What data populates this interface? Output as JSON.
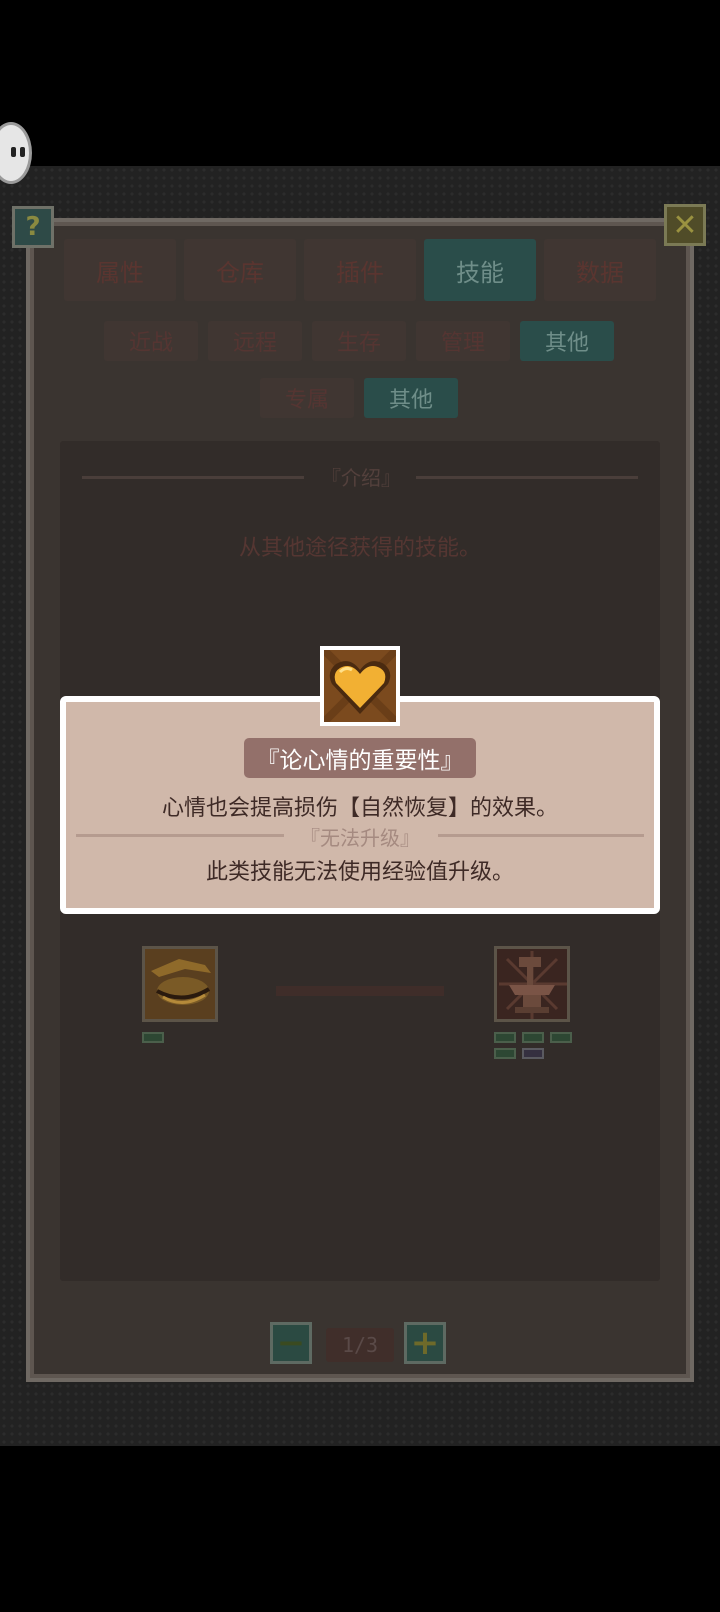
{
  "tabs": [
    {
      "label": "属性",
      "active": false
    },
    {
      "label": "仓库",
      "active": false
    },
    {
      "label": "插件",
      "active": false
    },
    {
      "label": "技能",
      "active": true
    },
    {
      "label": "数据",
      "active": false
    }
  ],
  "subtabs_row1": [
    {
      "label": "近战",
      "active": false
    },
    {
      "label": "远程",
      "active": false
    },
    {
      "label": "生存",
      "active": false
    },
    {
      "label": "管理",
      "active": false
    },
    {
      "label": "其他",
      "active": true
    }
  ],
  "subtabs_row2": [
    {
      "label": "专属",
      "active": false
    },
    {
      "label": "其他",
      "active": true
    }
  ],
  "help_label": "?",
  "close_label": "✕",
  "intro": {
    "heading": "『介绍』",
    "text": "从其他途径获得的技能。"
  },
  "tooltip": {
    "icon": "heart-icon",
    "name": "『论心情的重要性』",
    "description": "心情也会提高损伤【自然恢复】的效果。",
    "sublabel": "『无法升级』",
    "subtext": "此类技能无法使用经验值升级。"
  },
  "skill_nodes": [
    {
      "icon": "closed-eye-icon",
      "levels_filled": 1,
      "levels_total": 1
    },
    {
      "icon": "anvil-icon",
      "levels_filled": 4,
      "levels_total": 5
    }
  ],
  "pager": {
    "minus": "−",
    "plus": "+",
    "indicator": "1/3"
  },
  "colors": {
    "active_tab": "#2a4d4a",
    "tooltip_bg": "#d0b8aa",
    "badge": "#93706a"
  }
}
